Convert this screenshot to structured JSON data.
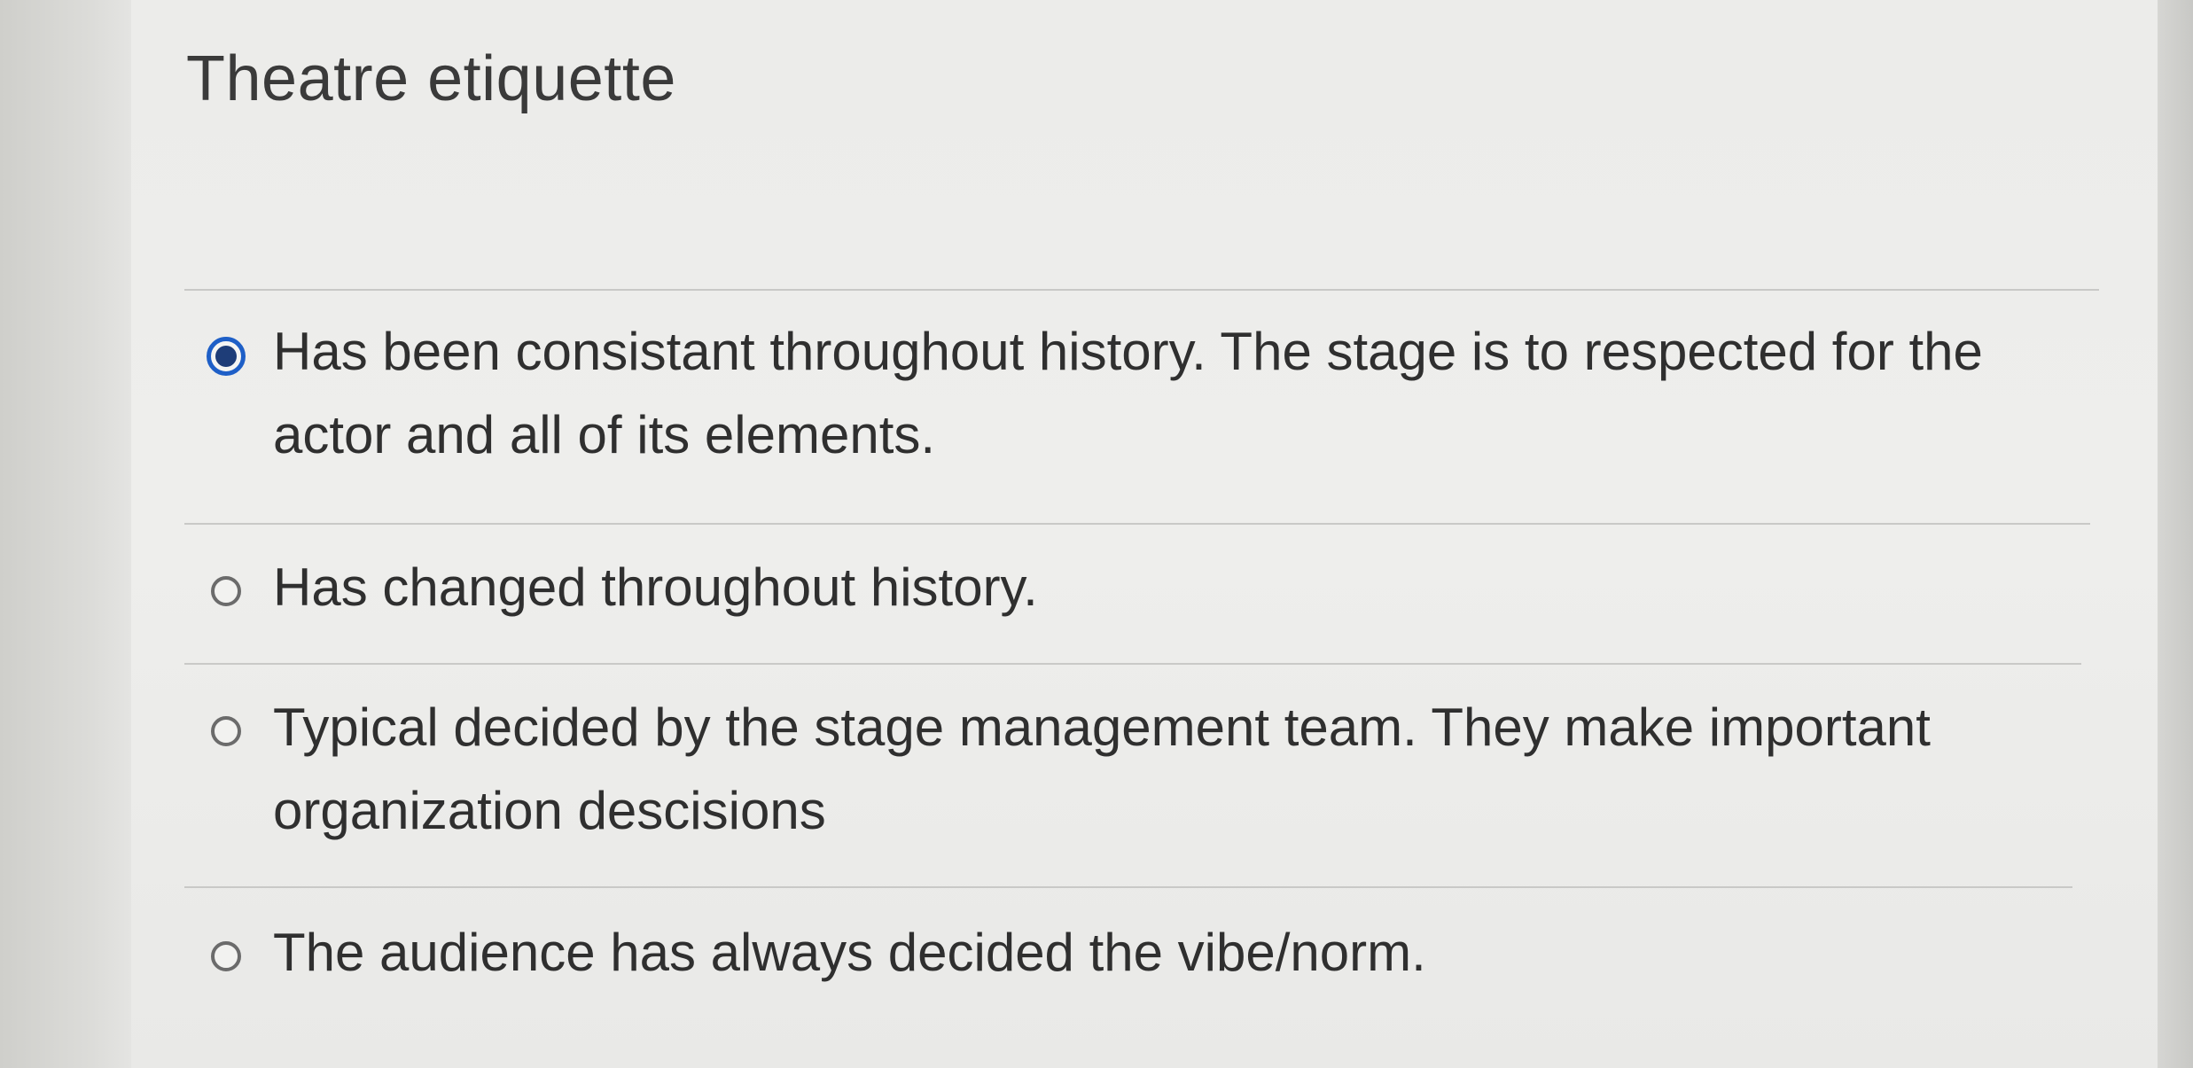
{
  "question": {
    "title": "Theatre etiquette"
  },
  "answers": [
    {
      "label": "Has been consistant throughout history. The stage is to respected for the actor and all of its elements.",
      "selected": true
    },
    {
      "label": "Has changed throughout history.",
      "selected": false
    },
    {
      "label": "Typical decided by the stage management team. They make important organization descisions",
      "selected": false
    },
    {
      "label": "The audience has always decided the vibe/norm.",
      "selected": false
    }
  ],
  "colors": {
    "selected_radio": "#1e5fc7",
    "text": "#2f2f2f"
  }
}
